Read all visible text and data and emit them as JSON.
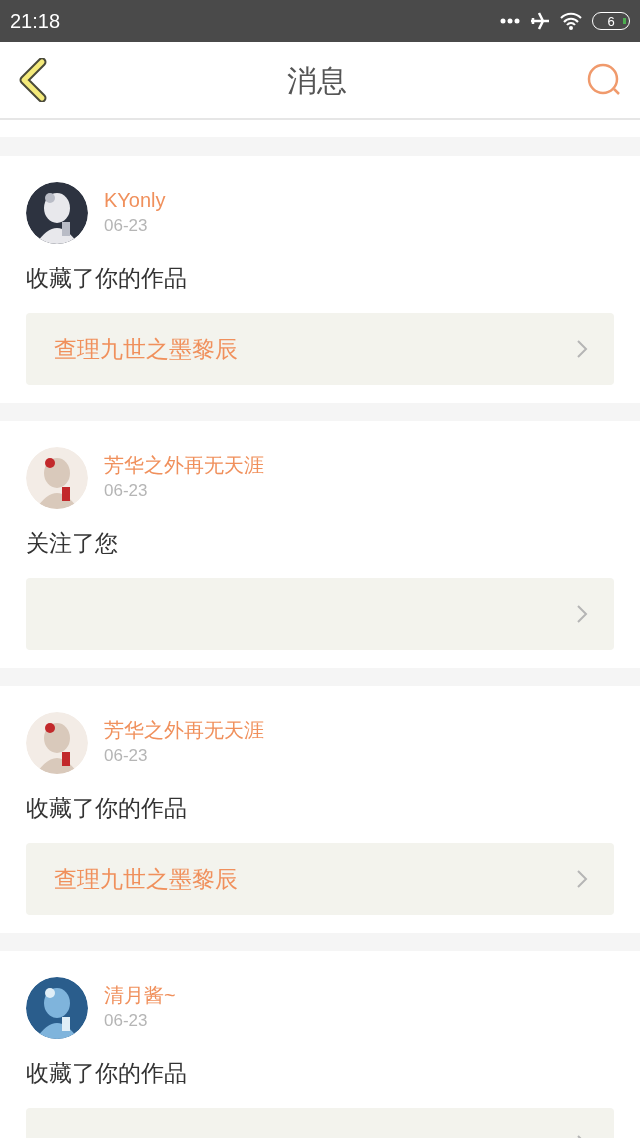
{
  "status_bar": {
    "time": "21:18",
    "battery": "6"
  },
  "header": {
    "title": "消息"
  },
  "messages": [
    {
      "user": "KYonly",
      "date": "06-23",
      "action": "收藏了你的作品",
      "work": "查理九世之墨黎辰"
    },
    {
      "user": "芳华之外再无天涯",
      "date": "06-23",
      "action": "关注了您"
    },
    {
      "user": "芳华之外再无天涯",
      "date": "06-23",
      "action": "收藏了你的作品",
      "work": "查理九世之墨黎辰"
    },
    {
      "user": "清月酱~",
      "date": "06-23",
      "action": "收藏了你的作品"
    }
  ]
}
